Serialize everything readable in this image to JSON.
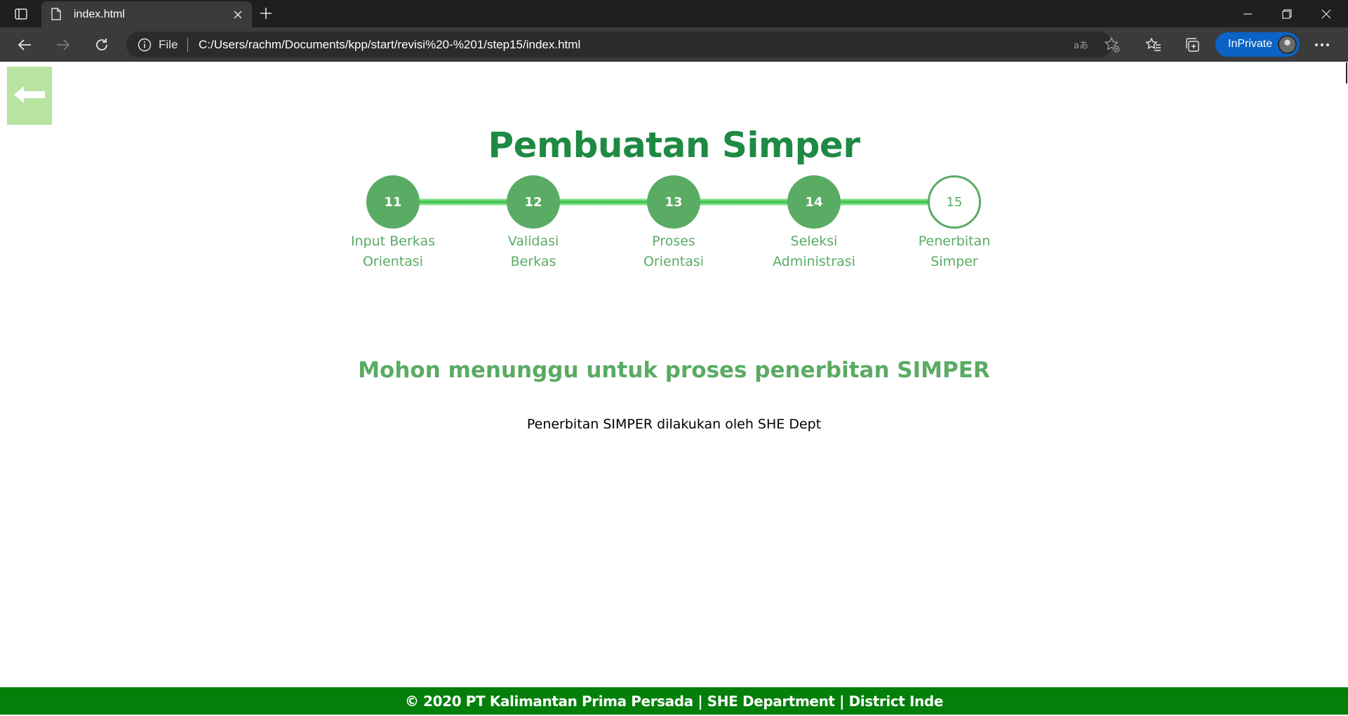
{
  "browser": {
    "tab_title": "index.html",
    "scheme_label": "File",
    "url": "C:/Users/rachm/Documents/kpp/start/revisi%20-%201/step15/index.html",
    "inprivate_label": "InPrivate",
    "accent_color": "#0a63c5"
  },
  "page": {
    "title": "Pembuatan Simper",
    "steps": [
      {
        "number": "11",
        "label_line1": "Input Berkas",
        "label_line2": "Orientasi",
        "state": "done"
      },
      {
        "number": "12",
        "label_line1": "Validasi",
        "label_line2": "Berkas",
        "state": "done"
      },
      {
        "number": "13",
        "label_line1": "Proses",
        "label_line2": "Orientasi",
        "state": "done"
      },
      {
        "number": "14",
        "label_line1": "Seleksi",
        "label_line2": "Administrasi",
        "state": "done"
      },
      {
        "number": "15",
        "label_line1": "Penerbitan",
        "label_line2": "Simper",
        "state": "current"
      }
    ],
    "message": "Mohon menunggu untuk proses penerbitan SIMPER",
    "sub_message": "Penerbitan SIMPER dilakukan oleh SHE Dept",
    "footer": "© 2020 PT Kalimantan Prima Persada | SHE Department | District Inde",
    "colors": {
      "title": "#1e8a43",
      "step": "#5aab63",
      "footer_bg": "#037f0a",
      "back_button_bg": "#b9e3a1"
    }
  },
  "icons": [
    "tab-actions-icon",
    "file-icon",
    "close-icon",
    "plus-icon",
    "minimize-icon",
    "restore-icon",
    "window-close-icon",
    "back-arrow-icon",
    "forward-arrow-icon",
    "refresh-icon",
    "info-icon",
    "read-aloud-icon",
    "add-favorite-icon",
    "favorites-icon",
    "collections-icon",
    "more-icon",
    "arrow-left-icon"
  ]
}
